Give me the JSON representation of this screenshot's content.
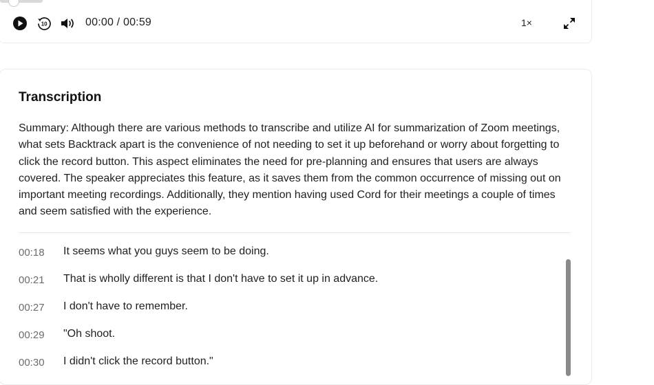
{
  "player": {
    "time_display": "00:00 / 00:59",
    "speed_label": "1×",
    "icons": [
      "play-icon",
      "rewind-10-icon",
      "volume-icon",
      "fullscreen-icon"
    ]
  },
  "transcription": {
    "title": "Transcription",
    "summary": "Summary: Although there are various methods to transcribe and utilize AI for summarization of Zoom meetings, what sets Backtrack apart is the convenience of not needing to set it up beforehand or worry about forgetting to click the record button. This aspect eliminates the need for pre-planning and ensures that users are always covered. The speaker appreciates this feature, as it saves them from the common occurrence of missing out on important meeting recordings. Additionally, they mention having used Cord for their meetings a couple of times and seem satisfied with the experience.",
    "lines": [
      {
        "time": "00:18",
        "text": "It seems what you guys seem to be doing."
      },
      {
        "time": "00:21",
        "text": "That is wholly different is that I don't have to set it up in advance."
      },
      {
        "time": "00:27",
        "text": "I don't have to remember."
      },
      {
        "time": "00:29",
        "text": "\"Oh shoot."
      },
      {
        "time": "00:30",
        "text": "I didn't click the record button.\""
      }
    ]
  }
}
